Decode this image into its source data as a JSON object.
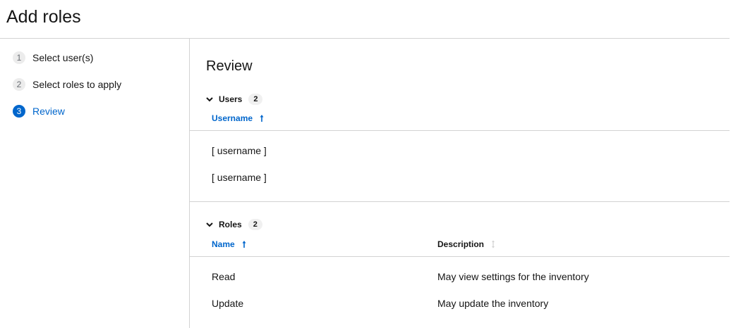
{
  "header": {
    "title": "Add roles"
  },
  "wizard": {
    "steps": [
      {
        "num": "1",
        "label": "Select user(s)"
      },
      {
        "num": "2",
        "label": "Select roles to apply"
      },
      {
        "num": "3",
        "label": "Review"
      }
    ],
    "current_step": 3
  },
  "review": {
    "title": "Review",
    "users": {
      "label": "Users",
      "count": "2",
      "columns": {
        "username": "Username"
      },
      "rows": [
        {
          "username": "[ username ]"
        },
        {
          "username": "[ username ]"
        }
      ]
    },
    "roles": {
      "label": "Roles",
      "count": "2",
      "columns": {
        "name": "Name",
        "description": "Description"
      },
      "rows": [
        {
          "name": "Read",
          "description": "May view settings for the inventory"
        },
        {
          "name": "Update",
          "description": "May update the inventory"
        }
      ]
    }
  },
  "colors": {
    "accent": "#0066cc",
    "border": "#d2d2d2",
    "text": "#151515"
  },
  "icons": {
    "section_toggle": "chevron-down-icon",
    "sort_active": "sort-ascending-icon",
    "sort_inactive": "sort-unsorted-icon"
  }
}
